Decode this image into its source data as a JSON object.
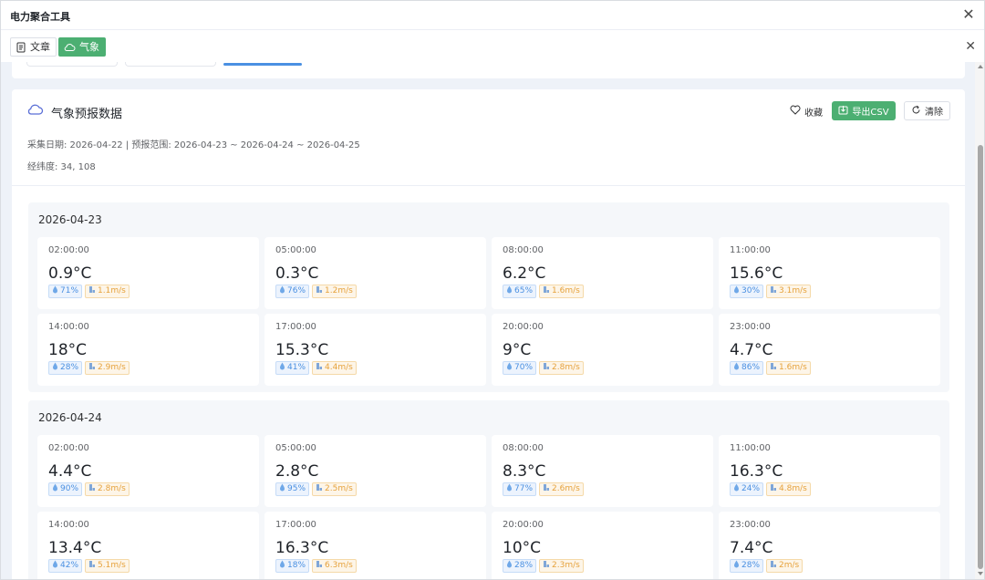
{
  "window": {
    "title": "电力聚合工具",
    "close_glyph": "✕"
  },
  "tabs": [
    {
      "label": "文章",
      "icon": "document-icon",
      "active": false
    },
    {
      "label": "气象",
      "icon": "cloud-icon",
      "active": true
    }
  ],
  "tabs_close_glyph": "✕",
  "panel": {
    "title": "气象预报数据",
    "meta_line1": "采集日期: 2026-04-22 | 预报范围: 2026-04-23 ~ 2026-04-24 ~ 2026-04-25",
    "meta_line2": "经纬度: 34, 108",
    "actions": {
      "favorite": "收藏",
      "export": "导出CSV",
      "clear": "清除"
    }
  },
  "colors": {
    "accent_green": "#4caf72",
    "humidity_blue": "#4a90e2",
    "wind_orange": "#e6a23c",
    "page_bg": "#eef2f8"
  },
  "days": [
    {
      "date": "2026-04-23",
      "slots": [
        {
          "time": "02:00:00",
          "temp": "0.9°C",
          "humidity": "71%",
          "wind": "1.1m/s"
        },
        {
          "time": "05:00:00",
          "temp": "0.3°C",
          "humidity": "76%",
          "wind": "1.2m/s"
        },
        {
          "time": "08:00:00",
          "temp": "6.2°C",
          "humidity": "65%",
          "wind": "1.6m/s"
        },
        {
          "time": "11:00:00",
          "temp": "15.6°C",
          "humidity": "30%",
          "wind": "3.1m/s"
        },
        {
          "time": "14:00:00",
          "temp": "18°C",
          "humidity": "28%",
          "wind": "2.9m/s"
        },
        {
          "time": "17:00:00",
          "temp": "15.3°C",
          "humidity": "41%",
          "wind": "4.4m/s"
        },
        {
          "time": "20:00:00",
          "temp": "9°C",
          "humidity": "70%",
          "wind": "2.8m/s"
        },
        {
          "time": "23:00:00",
          "temp": "4.7°C",
          "humidity": "86%",
          "wind": "1.6m/s"
        }
      ]
    },
    {
      "date": "2026-04-24",
      "slots": [
        {
          "time": "02:00:00",
          "temp": "4.4°C",
          "humidity": "90%",
          "wind": "2.8m/s"
        },
        {
          "time": "05:00:00",
          "temp": "2.8°C",
          "humidity": "95%",
          "wind": "2.5m/s"
        },
        {
          "time": "08:00:00",
          "temp": "8.3°C",
          "humidity": "77%",
          "wind": "2.6m/s"
        },
        {
          "time": "11:00:00",
          "temp": "16.3°C",
          "humidity": "24%",
          "wind": "4.8m/s"
        },
        {
          "time": "14:00:00",
          "temp": "13.4°C",
          "humidity": "42%",
          "wind": "5.1m/s"
        },
        {
          "time": "17:00:00",
          "temp": "16.3°C",
          "humidity": "18%",
          "wind": "6.3m/s"
        },
        {
          "time": "20:00:00",
          "temp": "10°C",
          "humidity": "28%",
          "wind": "2.3m/s"
        },
        {
          "time": "23:00:00",
          "temp": "7.4°C",
          "humidity": "28%",
          "wind": "2m/s"
        }
      ]
    }
  ]
}
